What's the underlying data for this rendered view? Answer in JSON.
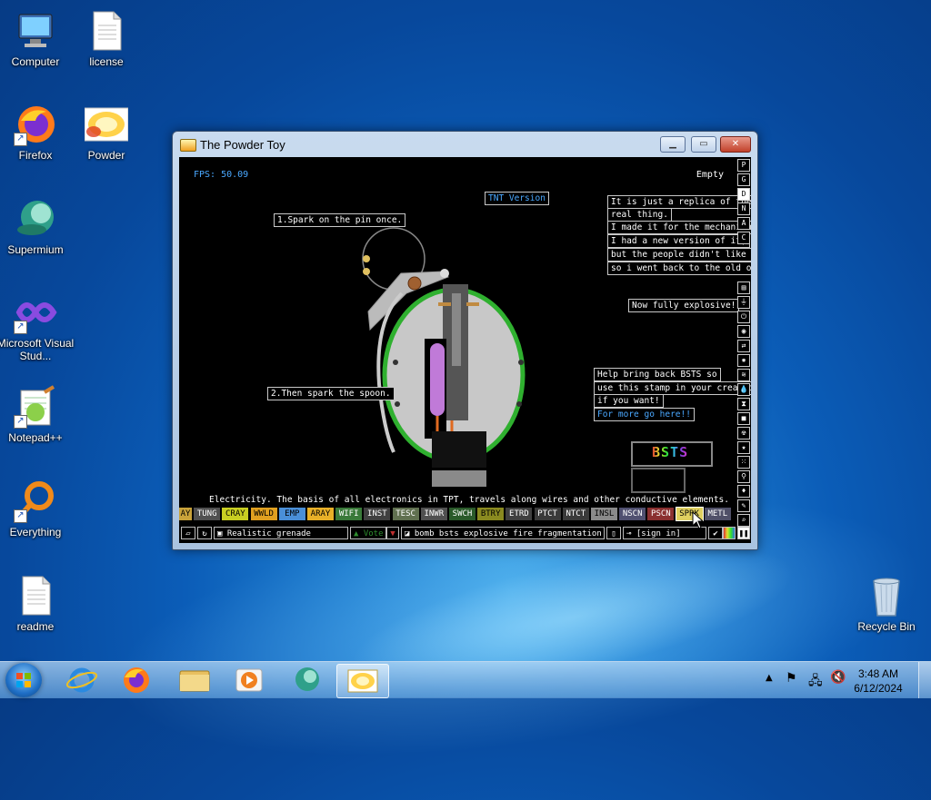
{
  "desktop": {
    "icons": [
      {
        "label": "Computer"
      },
      {
        "label": "license"
      },
      {
        "label": "Firefox"
      },
      {
        "label": "Powder"
      },
      {
        "label": "Supermium"
      },
      {
        "label": "Microsoft Visual Stud..."
      },
      {
        "label": "Notepad++"
      },
      {
        "label": "Everything"
      },
      {
        "label": "readme"
      },
      {
        "label": "Recycle Bin"
      }
    ]
  },
  "window": {
    "title": "The Powder Toy",
    "fps": "FPS: 50.09",
    "hover_status": "Empty",
    "signs": {
      "tnt": "TNT Version",
      "step1": "1.Spark on the pin once.",
      "step2": "2.Then spark the spoon.",
      "replica_1": "It is just a replica of the",
      "replica_2": "real thing.",
      "replica_3": "I made it for the mechanism.",
      "replica_4": "I had a new version of it,",
      "replica_5": "but the people didn't like it,",
      "replica_6": "so i went back to the old one!",
      "explosive": "Now fully explosive!",
      "bsts_1": "Help bring back BSTS so",
      "bsts_2": "use this stamp in your creatio",
      "bsts_3": "if you want!",
      "bsts_link": "For more go here!!",
      "bsts_logo": "BSTS"
    },
    "side_buttons": [
      "P",
      "G",
      "D",
      "N",
      "A",
      "C"
    ],
    "element_description": "Electricity. The basis of all electronics in TPT, travels along wires and other conductive elements.",
    "elements": [
      {
        "name": "AY",
        "color": "#c9a23a",
        "text": "#000"
      },
      {
        "name": "TUNG",
        "color": "#505050",
        "text": "#fff"
      },
      {
        "name": "CRAY",
        "color": "#c8ce22",
        "text": "#000"
      },
      {
        "name": "WWLD",
        "color": "#e0a020",
        "text": "#000"
      },
      {
        "name": "EMP",
        "color": "#4a8fd8",
        "text": "#000"
      },
      {
        "name": "ARAY",
        "color": "#e8b028",
        "text": "#000"
      },
      {
        "name": "WIFI",
        "color": "#3a7a3a",
        "text": "#fff"
      },
      {
        "name": "INST",
        "color": "#404040",
        "text": "#fff"
      },
      {
        "name": "TESC",
        "color": "#607050",
        "text": "#fff"
      },
      {
        "name": "INWR",
        "color": "#505050",
        "text": "#fff"
      },
      {
        "name": "SWCH",
        "color": "#2a5a2a",
        "text": "#fff"
      },
      {
        "name": "BTRY",
        "color": "#8a8a20",
        "text": "#000"
      },
      {
        "name": "ETRD",
        "color": "#404040",
        "text": "#fff"
      },
      {
        "name": "PTCT",
        "color": "#3a3a3a",
        "text": "#fff"
      },
      {
        "name": "NTCT",
        "color": "#3a3a3a",
        "text": "#fff"
      },
      {
        "name": "INSL",
        "color": "#8a8a8a",
        "text": "#000"
      },
      {
        "name": "NSCN",
        "color": "#505070",
        "text": "#fff"
      },
      {
        "name": "PSCN",
        "color": "#8a3030",
        "text": "#fff"
      },
      {
        "name": "SPRK",
        "color": "#e0d060",
        "text": "#000"
      },
      {
        "name": "METL",
        "color": "#505068",
        "text": "#fff"
      }
    ],
    "bottom": {
      "save_name": "Realistic grenade",
      "vote_label": "Vote",
      "tags": "bomb bsts explosive fire fragmentation g...",
      "sign_in": "[sign in]"
    }
  },
  "taskbar": {
    "time": "3:48 AM",
    "date": "6/12/2024"
  }
}
